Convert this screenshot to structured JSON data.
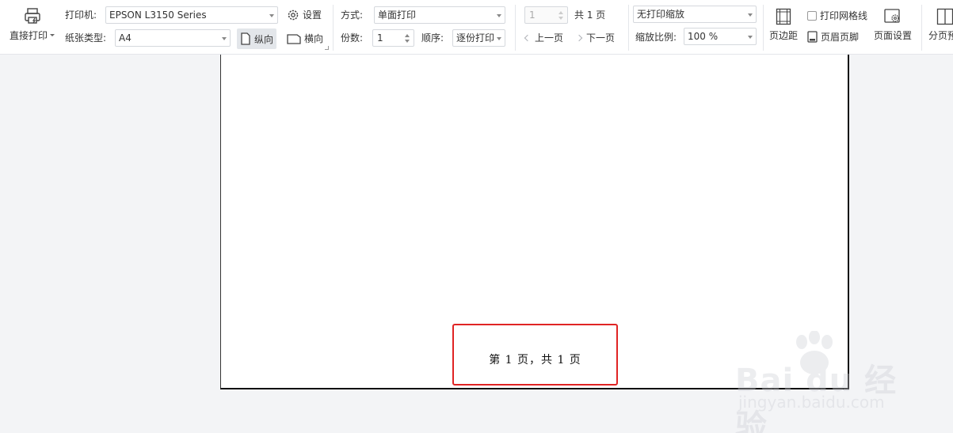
{
  "toolbar": {
    "direct_print": "直接打印",
    "printer_label": "打印机:",
    "printer_value": "EPSON L3150 Series",
    "settings": "设置",
    "paper_label": "纸张类型:",
    "paper_value": "A4",
    "portrait": "纵向",
    "landscape": "横向",
    "mode_label": "方式:",
    "mode_value": "单面打印",
    "copies_label": "份数:",
    "copies_value": "1",
    "order_label": "顺序:",
    "order_value": "逐份打印",
    "page_value": "1",
    "total_pages": "共 1 页",
    "prev_page": "上一页",
    "next_page": "下一页",
    "scale_mode": "无打印缩放",
    "scale_label": "缩放比例:",
    "scale_value": "100 %",
    "margins": "页边距",
    "print_gridlines": "打印网格线",
    "header_footer": "页眉页脚",
    "page_setup": "页面设置",
    "page_preview": "分页预"
  },
  "page": {
    "footer_text": "第 1 页，共 1 页"
  },
  "watermark": {
    "brand": "Bai du 经验",
    "url": "jingyan.baidu.com"
  },
  "icons": [
    "printer-icon",
    "gear-icon",
    "portrait-page-icon",
    "landscape-page-icon",
    "chevron-left-icon",
    "chevron-right-icon",
    "margins-icon",
    "checkbox-icon",
    "header-footer-icon",
    "page-setup-icon",
    "page-break-preview-icon"
  ],
  "colors": {
    "highlight_border": "#e02424",
    "toolbar_bg": "#ffffff",
    "workspace_bg": "#f3f4f6"
  }
}
